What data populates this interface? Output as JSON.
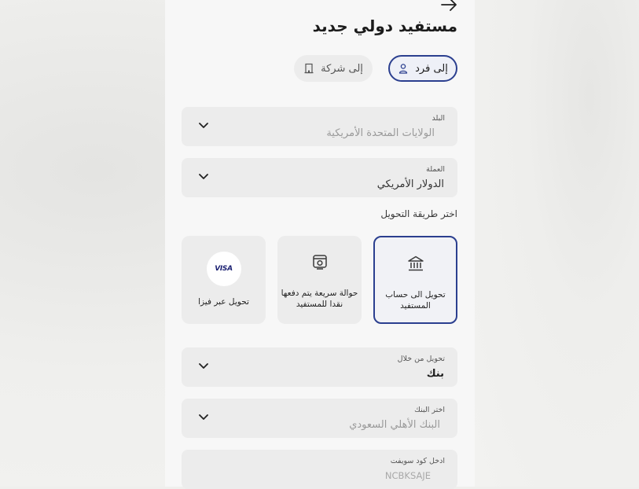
{
  "header": {
    "title": "مستفيد دولي جديد"
  },
  "beneficiary_type": {
    "individual": "إلى فرد",
    "company": "إلى شركة",
    "selected": "individual"
  },
  "country": {
    "label": "البلد",
    "value": "الولايات المتحدة الأمريكية"
  },
  "currency": {
    "label": "العملة",
    "value": "الدولار الأمريكي"
  },
  "transfer_method": {
    "label": "اختر طريقة التحويل",
    "options": [
      {
        "label": "تحويل الى حساب المستفيد",
        "icon": "bank-icon",
        "selected": true
      },
      {
        "label": "حوالة سريعة يتم دفعها نقدا للمستفيد",
        "icon": "cash-icon",
        "selected": false
      },
      {
        "label": "تحويل عبر فيزا",
        "icon": "visa-logo",
        "selected": false
      }
    ],
    "visa_logo_text": "VISA"
  },
  "transfer_through": {
    "label": "تحويل من خلال",
    "value": "بنك"
  },
  "bank": {
    "label": "اختر البنك",
    "value": "البنك الأهلي السعودي"
  },
  "swift": {
    "label": "ادخل كود سويفت",
    "placeholder": "NCBKSAJE"
  },
  "colors": {
    "accent": "#2b3f8f",
    "field_bg": "#ececec",
    "screen_bg": "#f7f7f7"
  }
}
